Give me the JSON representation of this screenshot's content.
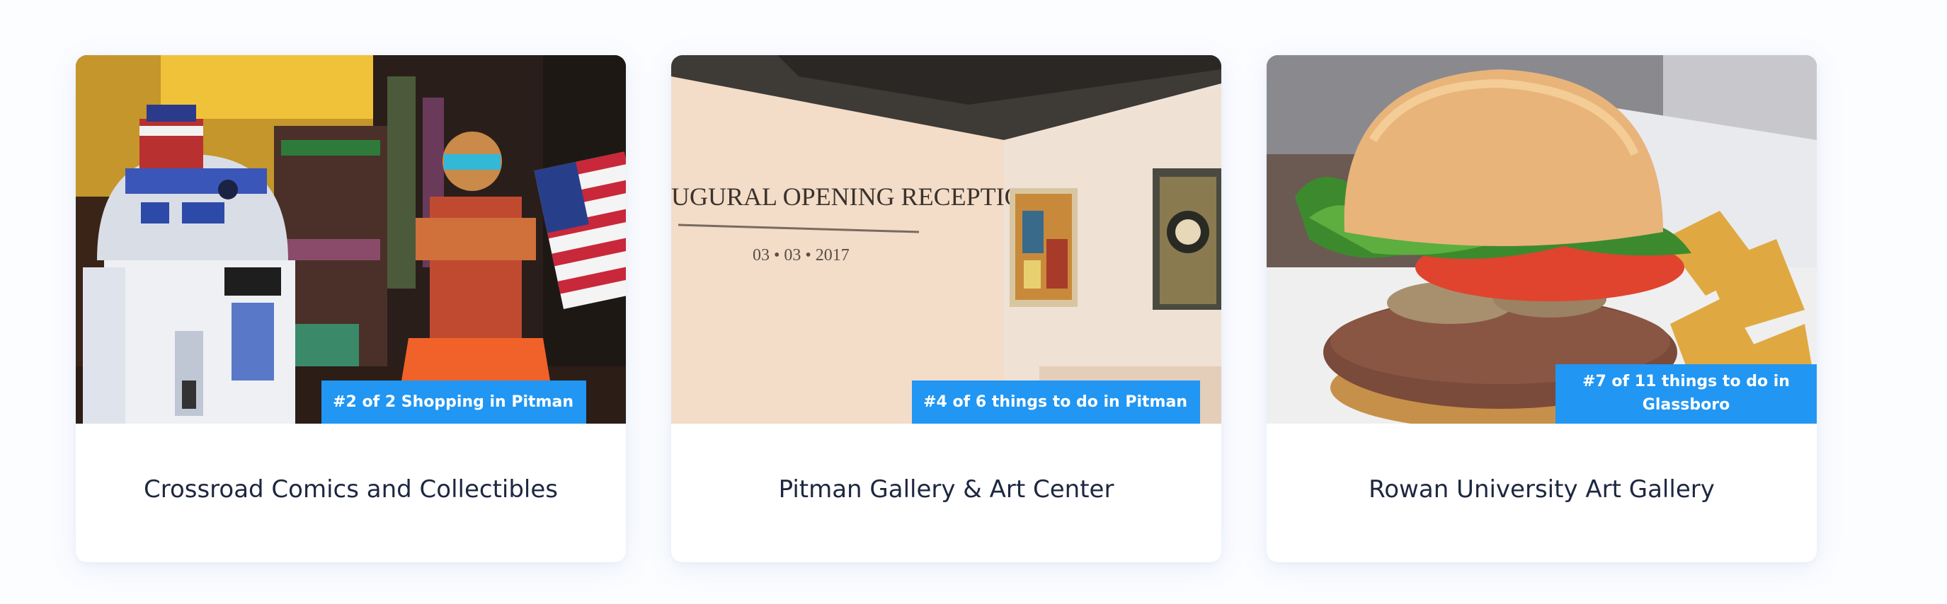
{
  "cards": [
    {
      "title": "Crossroad Comics and Collectibles",
      "badge": "#2 of 2 Shopping in Pitman",
      "image_subject": "comic shop interior with R2-D2 statue and American flag"
    },
    {
      "title": "Pitman Gallery & Art Center",
      "badge": "#4 of 6 things to do in Pitman",
      "image_subject": "gallery wall with opening reception lettering and paintings",
      "wall_text_line1": "UGURAL OPENING RECEPTION",
      "wall_text_line2": "03 • 03 • 2017"
    },
    {
      "title": "Rowan University Art Gallery",
      "badge": "#7 of 11 things to do in Glassboro",
      "image_subject": "hamburger with lettuce and tomato and chips"
    }
  ],
  "colors": {
    "badge_bg": "#2196f3",
    "badge_text": "#ffffff",
    "title_text": "#1d2740",
    "page_bg": "#fcfdff"
  }
}
